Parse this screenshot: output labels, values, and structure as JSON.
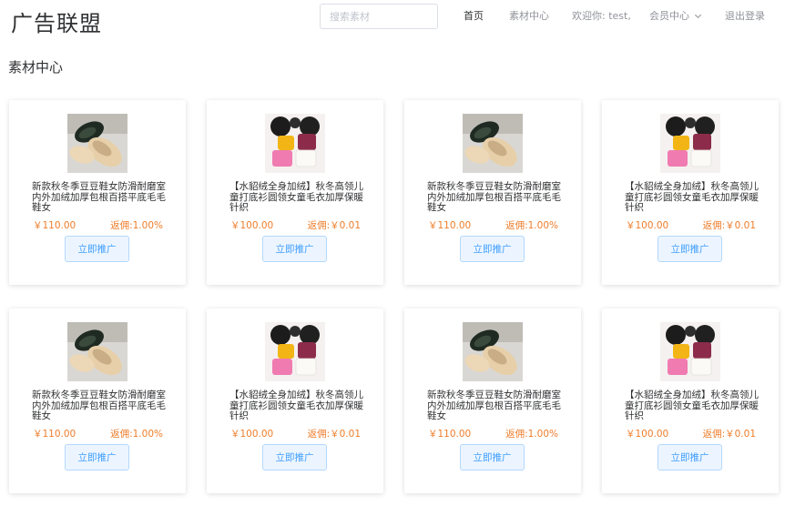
{
  "header": {
    "logo": "广告联盟",
    "search_placeholder": "搜索素材",
    "nav": {
      "home": "首页",
      "materials": "素材中心",
      "welcome": "欢迎你: test,",
      "member": "会员中心",
      "logout": "退出登录"
    }
  },
  "page": {
    "title": "素材中心"
  },
  "products": [
    {
      "image": "shoes-photo",
      "title": "新款秋冬季豆豆鞋女防滑耐磨室内外加绒加厚包根百搭平底毛毛鞋女",
      "price": "￥110.00",
      "rebate": "返佣:1.00%",
      "button": "立即推广"
    },
    {
      "image": "sweater-photo",
      "title": "【水貂绒全身加绒】秋冬高领儿童打底衫圆领女童毛衣加厚保暖针织",
      "price": "￥100.00",
      "rebate": "返佣:￥0.01",
      "button": "立即推广"
    },
    {
      "image": "shoes-photo",
      "title": "新款秋冬季豆豆鞋女防滑耐磨室内外加绒加厚包根百搭平底毛毛鞋女",
      "price": "￥110.00",
      "rebate": "返佣:1.00%",
      "button": "立即推广"
    },
    {
      "image": "sweater-photo",
      "title": "【水貂绒全身加绒】秋冬高领儿童打底衫圆领女童毛衣加厚保暖针织",
      "price": "￥100.00",
      "rebate": "返佣:￥0.01",
      "button": "立即推广"
    },
    {
      "image": "shoes-photo",
      "title": "新款秋冬季豆豆鞋女防滑耐磨室内外加绒加厚包根百搭平底毛毛鞋女",
      "price": "￥110.00",
      "rebate": "返佣:1.00%",
      "button": "立即推广"
    },
    {
      "image": "sweater-photo",
      "title": "【水貂绒全身加绒】秋冬高领儿童打底衫圆领女童毛衣加厚保暖针织",
      "price": "￥100.00",
      "rebate": "返佣:￥0.01",
      "button": "立即推广"
    },
    {
      "image": "shoes-photo",
      "title": "新款秋冬季豆豆鞋女防滑耐磨室内外加绒加厚包根百搭平底毛毛鞋女",
      "price": "￥110.00",
      "rebate": "返佣:1.00%",
      "button": "立即推广"
    },
    {
      "image": "sweater-photo",
      "title": "【水貂绒全身加绒】秋冬高领儿童打底衫圆领女童毛衣加厚保暖针织",
      "price": "￥100.00",
      "rebate": "返佣:￥0.01",
      "button": "立即推广"
    }
  ],
  "colors": {
    "accent": "#409eff",
    "price": "#ee7d2b",
    "button_bg": "#ecf5ff",
    "button_border": "#b3d8ff"
  }
}
